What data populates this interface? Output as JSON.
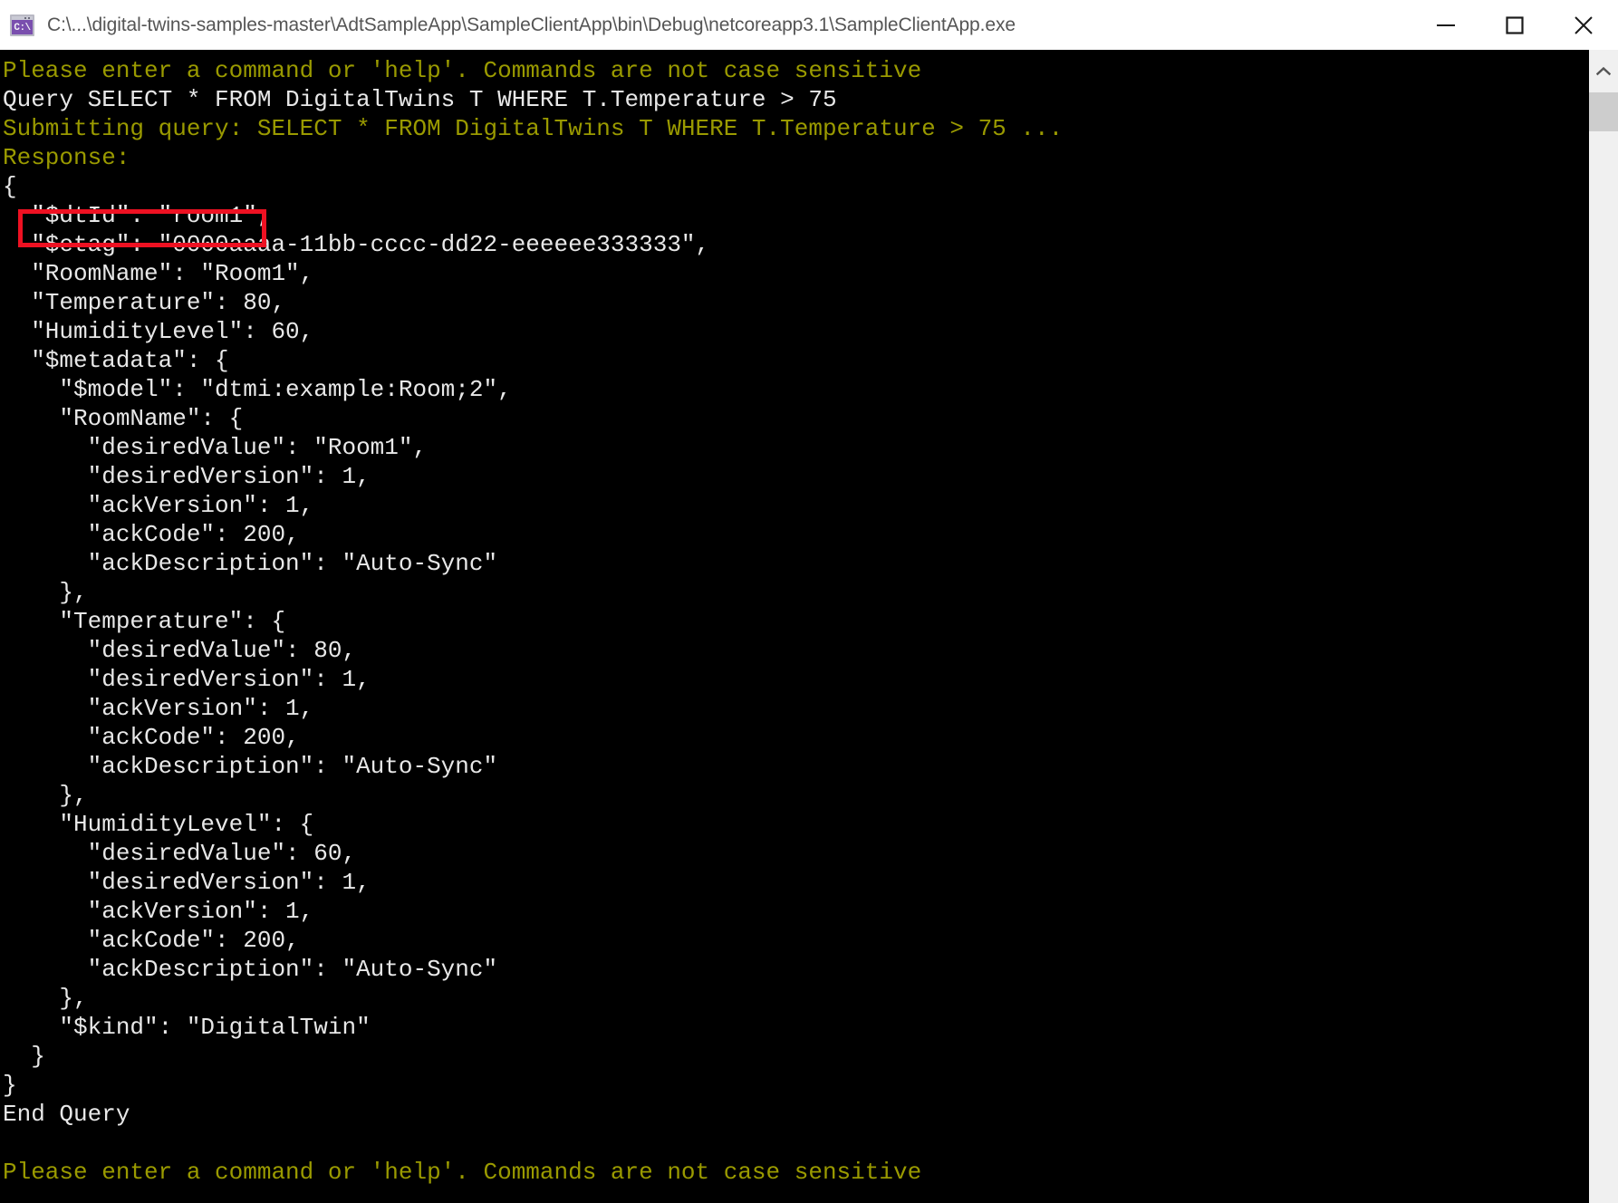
{
  "window": {
    "title": "C:\\...\\digital-twins-samples-master\\AdtSampleApp\\SampleClientApp\\bin\\Debug\\netcoreapp3.1\\SampleClientApp.exe",
    "icon_glyph": "C:\\",
    "icon_name": "console-app-icon",
    "controls": {
      "minimize": "—",
      "maximize": "□",
      "close": "✕"
    }
  },
  "colors": {
    "titlebar_bg": "#ffffff",
    "title_text": "#555555",
    "console_bg": "#000000",
    "console_text": "#e8e8e8",
    "console_prompt": "#9a9a00",
    "highlight_border": "#ee1122",
    "scrollbar_track": "#f0f0f0",
    "scrollbar_thumb": "#cdcdcd"
  },
  "console": {
    "lines": [
      {
        "text": "Please enter a command or 'help'. Commands are not case sensitive",
        "color": "yellow"
      },
      {
        "text": "Query SELECT * FROM DigitalTwins T WHERE T.Temperature > 75",
        "color": "white"
      },
      {
        "text": "Submitting query: SELECT * FROM DigitalTwins T WHERE T.Temperature > 75 ...",
        "color": "yellow"
      },
      {
        "text": "Response:",
        "color": "yellow"
      },
      {
        "text": "{",
        "color": "white"
      },
      {
        "text": "  \"$dtId\": \"room1\",",
        "color": "white"
      },
      {
        "text": "  \"$etag\": \"0000aaaa-11bb-cccc-dd22-eeeeee333333\",",
        "color": "white"
      },
      {
        "text": "  \"RoomName\": \"Room1\",",
        "color": "white"
      },
      {
        "text": "  \"Temperature\": 80,",
        "color": "white"
      },
      {
        "text": "  \"HumidityLevel\": 60,",
        "color": "white"
      },
      {
        "text": "  \"$metadata\": {",
        "color": "white"
      },
      {
        "text": "    \"$model\": \"dtmi:example:Room;2\",",
        "color": "white"
      },
      {
        "text": "    \"RoomName\": {",
        "color": "white"
      },
      {
        "text": "      \"desiredValue\": \"Room1\",",
        "color": "white"
      },
      {
        "text": "      \"desiredVersion\": 1,",
        "color": "white"
      },
      {
        "text": "      \"ackVersion\": 1,",
        "color": "white"
      },
      {
        "text": "      \"ackCode\": 200,",
        "color": "white"
      },
      {
        "text": "      \"ackDescription\": \"Auto-Sync\"",
        "color": "white"
      },
      {
        "text": "    },",
        "color": "white"
      },
      {
        "text": "    \"Temperature\": {",
        "color": "white"
      },
      {
        "text": "      \"desiredValue\": 80,",
        "color": "white"
      },
      {
        "text": "      \"desiredVersion\": 1,",
        "color": "white"
      },
      {
        "text": "      \"ackVersion\": 1,",
        "color": "white"
      },
      {
        "text": "      \"ackCode\": 200,",
        "color": "white"
      },
      {
        "text": "      \"ackDescription\": \"Auto-Sync\"",
        "color": "white"
      },
      {
        "text": "    },",
        "color": "white"
      },
      {
        "text": "    \"HumidityLevel\": {",
        "color": "white"
      },
      {
        "text": "      \"desiredValue\": 60,",
        "color": "white"
      },
      {
        "text": "      \"desiredVersion\": 1,",
        "color": "white"
      },
      {
        "text": "      \"ackVersion\": 1,",
        "color": "white"
      },
      {
        "text": "      \"ackCode\": 200,",
        "color": "white"
      },
      {
        "text": "      \"ackDescription\": \"Auto-Sync\"",
        "color": "white"
      },
      {
        "text": "    },",
        "color": "white"
      },
      {
        "text": "    \"$kind\": \"DigitalTwin\"",
        "color": "white"
      },
      {
        "text": "  }",
        "color": "white"
      },
      {
        "text": "}",
        "color": "white"
      },
      {
        "text": "End Query",
        "color": "white"
      },
      {
        "text": "",
        "color": "blank"
      },
      {
        "text": "Please enter a command or 'help'. Commands are not case sensitive",
        "color": "yellow"
      }
    ],
    "highlighted_line": "\"$dtId\": \"room1\","
  },
  "scrollbar": {
    "up_arrow": "scroll-up-arrow"
  }
}
